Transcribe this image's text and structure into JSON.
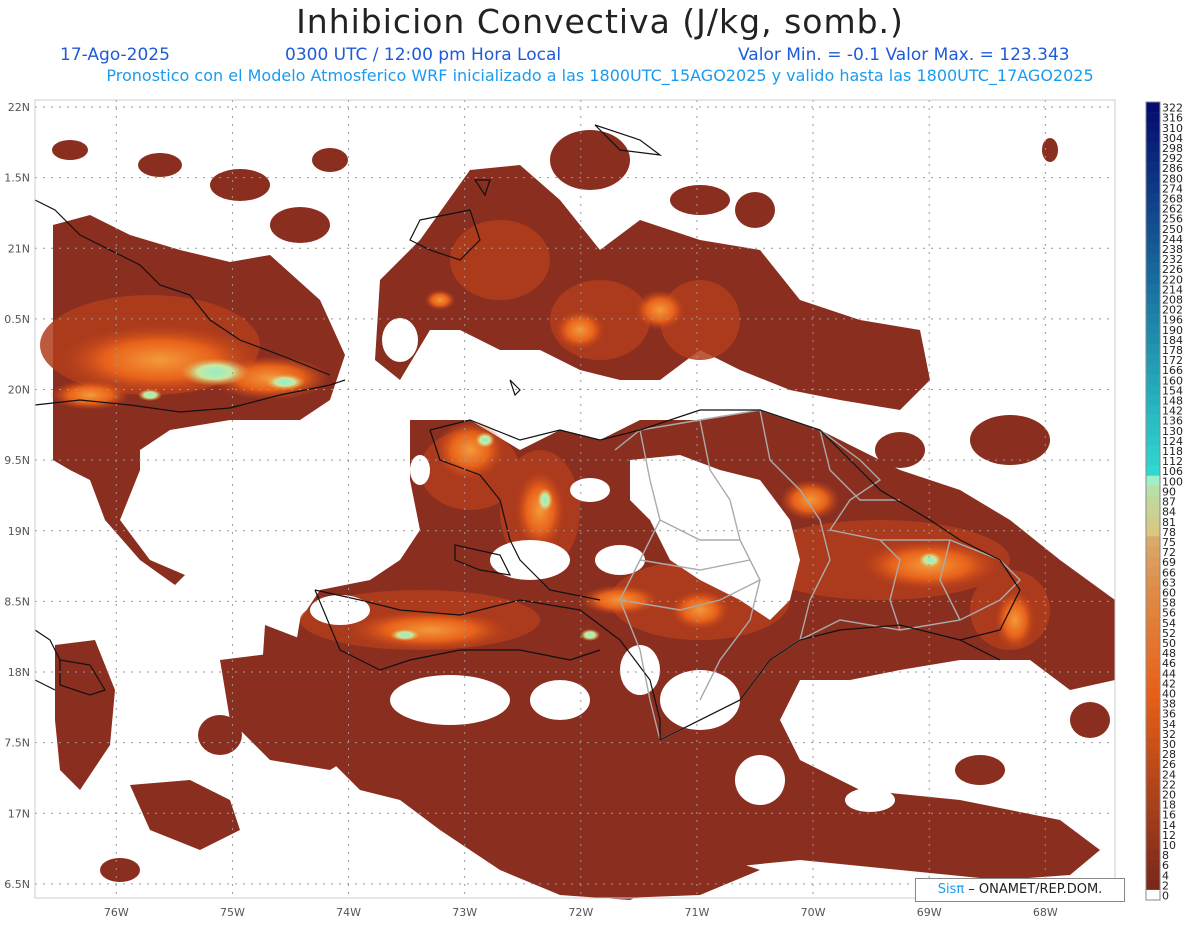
{
  "header": {
    "title": "Inhibicion Convectiva (J/kg, somb.)",
    "date": "17-Ago-2025",
    "time": "0300 UTC / 12:00 pm Hora Local",
    "min_max": "Valor Min. = -0.1  Valor Max. = 123.343",
    "subtitle": "Pronostico con el Modelo Atmosferico WRF inicializado a las 1800UTC_15AGO2025 y valido hasta las  1800UTC_17AGO2025"
  },
  "map": {
    "lon_range": [
      -76.7,
      -67.4
    ],
    "lat_range": [
      16.4,
      22.05
    ],
    "lon_ticks": [
      "76W",
      "75W",
      "74W",
      "73W",
      "72W",
      "71W",
      "70W",
      "69W",
      "68W"
    ],
    "lat_ticks": [
      "22N",
      "1.5N",
      "21N",
      "0.5N",
      "20N",
      "9.5N",
      "19N",
      "8.5N",
      "18N",
      "7.5N",
      "17N",
      "6.5N"
    ],
    "colors": {
      "field_dark": "#8a2e1f",
      "field_mid": "#c2441c",
      "field_hot": "#e8621a",
      "field_peak": "#7ee0c0",
      "coast": "#111111",
      "borders": "#aaaaaa",
      "grid": "#999999"
    }
  },
  "colorbar": {
    "labels": [
      "322",
      "316",
      "310",
      "304",
      "298",
      "292",
      "286",
      "280",
      "274",
      "268",
      "262",
      "256",
      "250",
      "244",
      "238",
      "232",
      "226",
      "220",
      "214",
      "208",
      "202",
      "196",
      "190",
      "184",
      "178",
      "172",
      "166",
      "160",
      "154",
      "148",
      "142",
      "136",
      "130",
      "124",
      "118",
      "112",
      "106",
      "100",
      "90",
      "87",
      "84",
      "81",
      "78",
      "75",
      "72",
      "69",
      "66",
      "63",
      "60",
      "58",
      "56",
      "54",
      "52",
      "50",
      "48",
      "46",
      "44",
      "42",
      "40",
      "38",
      "36",
      "34",
      "32",
      "30",
      "28",
      "26",
      "24",
      "22",
      "20",
      "18",
      "16",
      "14",
      "12",
      "10",
      "8",
      "6",
      "4",
      "2",
      "0"
    ]
  },
  "credit": {
    "sis": "Sisπ",
    "text": " –  ONAMET/REP.DOM."
  }
}
